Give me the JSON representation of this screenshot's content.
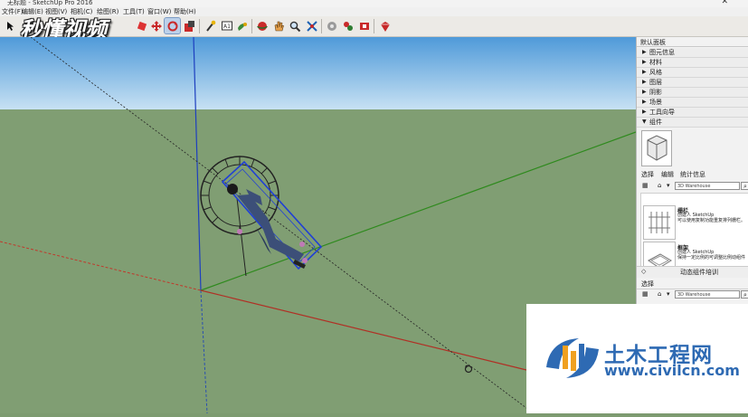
{
  "window": {
    "title": "无标题 - SketchUp Pro 2016",
    "close_glyph": "✕"
  },
  "menu": [
    "文件(F)",
    "编辑(E)",
    "视图(V)",
    "相机(C)",
    "绘图(R)",
    "工具(T)",
    "窗口(W)",
    "帮助(H)"
  ],
  "watermark_top": "秒懂视频",
  "toolbar": {
    "icons": [
      "select-arrow-icon",
      "pencil-line-icon",
      "tape-measure-icon",
      "paint-bucket-icon",
      "push-pull-icon",
      "move-icon",
      "rotate-icon",
      "scale-icon",
      "tape-icon",
      "text-icon",
      "paint-icon",
      "orbit-icon",
      "pan-icon",
      "zoom-icon",
      "zoom-extents-icon",
      "warehouse-icon",
      "extension-icon",
      "components-icon",
      "ruby-icon"
    ]
  },
  "tray": {
    "header": "默认面板",
    "panels": [
      {
        "label": "图元信息",
        "arrow": "▶"
      },
      {
        "label": "材料",
        "arrow": "▶"
      },
      {
        "label": "风格",
        "arrow": "▶"
      },
      {
        "label": "图层",
        "arrow": "▶"
      },
      {
        "label": "阴影",
        "arrow": "▶"
      },
      {
        "label": "场景",
        "arrow": "▶"
      },
      {
        "label": "工具向导",
        "arrow": "▶"
      },
      {
        "label": "组件",
        "arrow": "▼"
      }
    ],
    "tabs": [
      "选择",
      "编辑",
      "统计信息"
    ],
    "search_placeholder": "3D Warehouse",
    "search_placeholder2": "3D Warehouse",
    "items": [
      {
        "title": "栅栏",
        "desc": "创建人 SketchUp\n可以使用复制功能重复排列栅栏。"
      },
      {
        "title": "框架",
        "desc": "创建人 SketchUp\n保持一定比例的可调整比例动组件"
      }
    ],
    "dynamic_label": "动态组件培训",
    "select_label": "选择"
  },
  "site_watermark": {
    "cn": "土木工程网",
    "url": "www.civilcn.com"
  }
}
